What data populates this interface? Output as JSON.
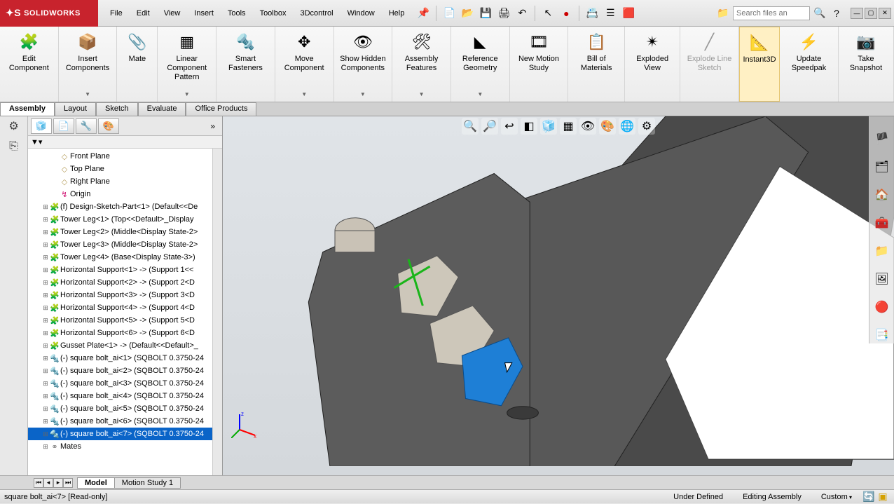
{
  "app": {
    "name": "SOLIDWORKS"
  },
  "menu": [
    "File",
    "Edit",
    "View",
    "Insert",
    "Tools",
    "Toolbox",
    "3Dcontrol",
    "Window",
    "Help"
  ],
  "search": {
    "placeholder": "Search files an"
  },
  "ribbon": [
    {
      "label": "Edit Component",
      "icon": "🧩",
      "arrow": false
    },
    {
      "label": "Insert Components",
      "icon": "📦",
      "arrow": true
    },
    {
      "label": "Mate",
      "icon": "📎",
      "arrow": false
    },
    {
      "label": "Linear Component Pattern",
      "icon": "▦",
      "arrow": true
    },
    {
      "label": "Smart Fasteners",
      "icon": "🔩",
      "arrow": false
    },
    {
      "label": "Move Component",
      "icon": "✥",
      "arrow": true
    },
    {
      "label": "Show Hidden Components",
      "icon": "👁",
      "arrow": true
    },
    {
      "label": "Assembly Features",
      "icon": "🛠",
      "arrow": true
    },
    {
      "label": "Reference Geometry",
      "icon": "◣",
      "arrow": true
    },
    {
      "label": "New Motion Study",
      "icon": "🎞",
      "arrow": false
    },
    {
      "label": "Bill of Materials",
      "icon": "📋",
      "arrow": false
    },
    {
      "label": "Exploded View",
      "icon": "✴",
      "arrow": false
    },
    {
      "label": "Explode Line Sketch",
      "icon": "╱",
      "arrow": false,
      "disabled": true
    },
    {
      "label": "Instant3D",
      "icon": "📐",
      "arrow": false,
      "active": true
    },
    {
      "label": "Update Speedpak",
      "icon": "⚡",
      "arrow": false
    },
    {
      "label": "Take Snapshot",
      "icon": "📷",
      "arrow": false
    }
  ],
  "tabs": [
    "Assembly",
    "Layout",
    "Sketch",
    "Evaluate",
    "Office Products"
  ],
  "active_tab": "Assembly",
  "tree": {
    "planes": [
      {
        "label": "Front Plane",
        "type": "plane"
      },
      {
        "label": "Top Plane",
        "type": "plane"
      },
      {
        "label": "Right Plane",
        "type": "plane"
      },
      {
        "label": "Origin",
        "type": "origin"
      }
    ],
    "items": [
      {
        "label": "(f) Design-Sketch-Part<1> (Default<<De",
        "type": "part"
      },
      {
        "label": "Tower Leg<1> (Top<<Default>_Display",
        "type": "part"
      },
      {
        "label": "Tower Leg<2> (Middle<Display State-2>",
        "type": "part"
      },
      {
        "label": "Tower Leg<3> (Middle<Display State-2>",
        "type": "part"
      },
      {
        "label": "Tower Leg<4> (Base<Display State-3>)",
        "type": "part"
      },
      {
        "label": "Horizontal Support<1> -> (Support 1<<",
        "type": "part"
      },
      {
        "label": "Horizontal Support<2> -> (Support 2<D",
        "type": "part"
      },
      {
        "label": "Horizontal Support<3> -> (Support 3<D",
        "type": "part"
      },
      {
        "label": "Horizontal Support<4> -> (Support 4<D",
        "type": "part"
      },
      {
        "label": "Horizontal Support<5> -> (Support 5<D",
        "type": "part"
      },
      {
        "label": "Horizontal Support<6> -> (Support 6<D",
        "type": "part"
      },
      {
        "label": "Gusset Plate<1> -> (Default<<Default>_",
        "type": "part"
      },
      {
        "label": "(-) square bolt_ai<1> (SQBOLT 0.3750-24",
        "type": "bolt"
      },
      {
        "label": "(-) square bolt_ai<2> (SQBOLT 0.3750-24",
        "type": "bolt"
      },
      {
        "label": "(-) square bolt_ai<3> (SQBOLT 0.3750-24",
        "type": "bolt"
      },
      {
        "label": "(-) square bolt_ai<4> (SQBOLT 0.3750-24",
        "type": "bolt"
      },
      {
        "label": "(-) square bolt_ai<5> (SQBOLT 0.3750-24",
        "type": "bolt"
      },
      {
        "label": "(-) square bolt_ai<6> (SQBOLT 0.3750-24",
        "type": "bolt"
      },
      {
        "label": "(-) square bolt_ai<7> (SQBOLT 0.3750-24",
        "type": "bolt",
        "selected": true
      },
      {
        "label": "Mates",
        "type": "mates"
      }
    ]
  },
  "sheet_tabs": [
    "Model",
    "Motion Study 1"
  ],
  "active_sheet": "Model",
  "status": {
    "left": "square bolt_ai<7> [Read-only]",
    "defined": "Under Defined",
    "mode": "Editing Assembly",
    "units": "Custom"
  }
}
